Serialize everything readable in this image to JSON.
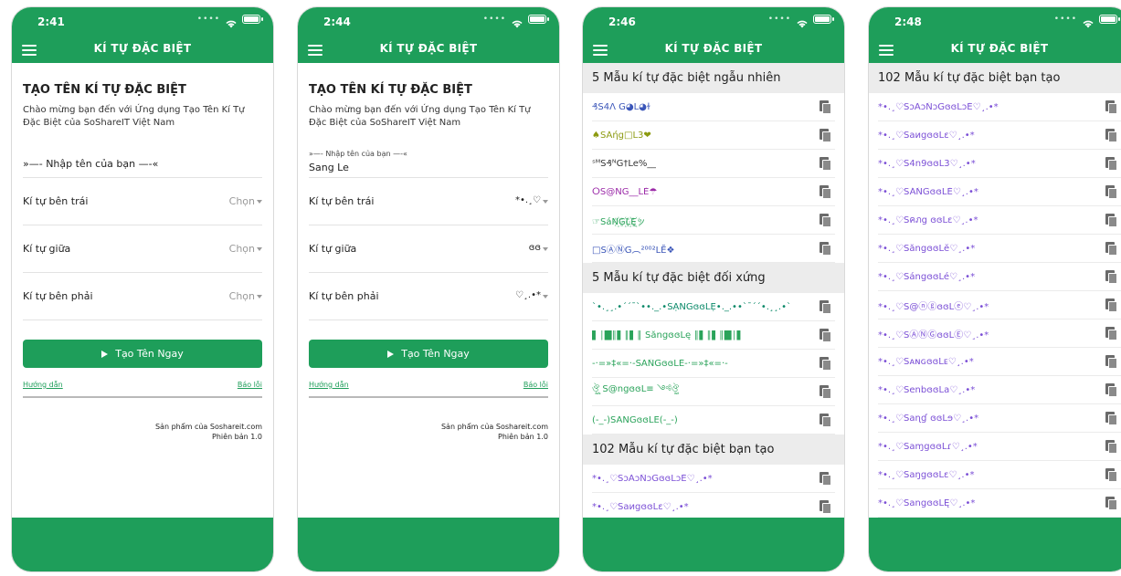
{
  "app_title": "KÍ TỰ ĐẶC BIỆT",
  "phones": [
    {
      "time": "2:41"
    },
    {
      "time": "2:44"
    },
    {
      "time": "2:46"
    },
    {
      "time": "2:48"
    }
  ],
  "form": {
    "title": "TẠO TÊN KÍ TỰ ĐẶC BIỆT",
    "description": "Chào mừng bạn đến với Ứng dụng Tạo Tên Kí Tự Đặc Biệt của SoShareIT Việt Nam",
    "name_placeholder": "»—- Nhập tên của bạn —-«",
    "name_label": "»—- Nhập tên của bạn —-«",
    "name_value": "Sang Le",
    "left_label": "Kí tự bên trái",
    "middle_label": "Kí tự giữa",
    "right_label": "Kí tự bên phải",
    "choose": "Chọn",
    "left_value": "*•.¸♡",
    "middle_value": "ɞɞ",
    "right_value": "♡¸.•*",
    "button_label": "Tạo Tên Ngay",
    "guide_link": "Hướng dẫn",
    "report_link": "Báo lỗi",
    "footer_line1": "Sản phẩm của Soshareit.com",
    "footer_line2": "Phiên bản 1.0"
  },
  "sections": {
    "random": "5 Mẫu kí tự đặc biệt ngẫu nhiên",
    "symmetric": "5 Mẫu kí tự đặc biệt đối xứng",
    "created": "102 Mẫu kí tự đặc biệt bạn tạo"
  },
  "random_items": [
    "₰S4Λ G◕L◕ɫ",
    "♠SÁήg□L3❤",
    "ˢᴹS₰ᴺG†Le%__",
    "ⵔS@NG__LĚ☂",
    "☞SáN꙰G꙰L꙰Ę꙰ッ",
    "□SⒶⓃG︵²⁰⁰²LĔ❖"
  ],
  "symmetric_items": [
    "`•.¸¸.•´´¯`••._.•SẠNGɞɞLẸ•._.••`¯´´•.¸¸.•`",
    "▌│█║▌║▌║ SăngɞɞLę ║▌║▌║█│▌",
    "-·=»‡«=·-SĂŇĞɞɞLĔ-·=»‡«=·-",
    "ঔৣ S@ngɞɞL≡ ༺ঔৣ",
    "(-_-)SANGɞɞLE(-_-)"
  ],
  "created_items_p3": [
    "*•.¸♡SↄĂↄŇↄĞɞɞLↄĔ♡¸.•*",
    "*•.¸♡SaиgɞɞLɛ♡¸.•*"
  ],
  "created_items_p4": [
    "*•.¸♡SↄĂↄŇↄĞɞɞLↄĔ♡¸.•*",
    "*•.¸♡SaиgɞɞLɛ♡¸.•*",
    "*•.¸♡S4n9ɞɞL3♡¸.•*",
    "*•.¸♡SÁŃĞɞɞLĔ♡¸.•*",
    "*•.¸♡Sคภg ɞɞLɛ♡¸.•*",
    "*•.¸♡SăngɞɞLĕ♡¸.•*",
    "*•.¸♡SángɞɞLé♡¸.•*",
    "*•.¸♡S@ⓝⓖɞɞLⓔ♡¸.•*",
    "*•.¸♡SⒶⓃⒼɞɞLⒺ♡¸.•*",
    "*•.¸♡SᴀɴɢɞɞLᴇ♡¸.•*",
    "*•.¸♡SenbɞɞLa♡¸.•*",
    "*•.¸♡Saɳɠ ɞɞLɘ♡¸.•*",
    "*•.¸♡SaɱgɞɞLɾ♡¸.•*",
    "*•.¸♡SaŋgɞɞLɛ♡¸.•*",
    "*•.¸♡SangɞɞLĘ♡¸.•*"
  ],
  "colors": {
    "primary": "#1e9e5a",
    "header_bg": "#ececec",
    "created_text": "#7b4fd6"
  },
  "icons": [
    "menu-icon",
    "wifi-icon",
    "battery-icon",
    "copy-icon",
    "play-icon",
    "caret-icon"
  ]
}
